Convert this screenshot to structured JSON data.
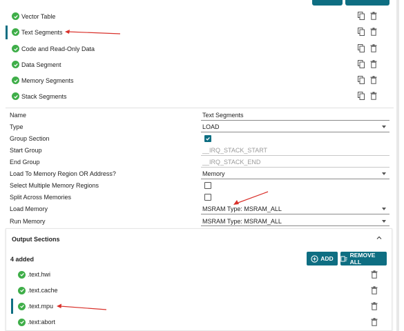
{
  "segments": [
    {
      "label": "Vector Table"
    },
    {
      "label": "Text Segments"
    },
    {
      "label": "Code and Read-Only Data"
    },
    {
      "label": "Data Segment"
    },
    {
      "label": "Memory Segments"
    },
    {
      "label": "Stack Segments"
    }
  ],
  "form": {
    "name_label": "Name",
    "name_value": "Text Segments",
    "type_label": "Type",
    "type_value": "LOAD",
    "group_section_label": "Group Section",
    "start_group_label": "Start Group",
    "start_group_placeholder": "__IRQ_STACK_START",
    "end_group_label": "End Group",
    "end_group_placeholder": "__IRQ_STACK_END",
    "load_to_label": "Load To Memory Region OR Address?",
    "load_to_value": "Memory",
    "select_multiple_label": "Select Multiple Memory Regions",
    "split_across_label": "Split Across Memories",
    "load_memory_label": "Load Memory",
    "load_memory_value": "MSRAM Type: MSRAM_ALL",
    "run_memory_label": "Run Memory",
    "run_memory_value": "MSRAM Type: MSRAM_ALL",
    "group_section_checked": true,
    "select_multiple_checked": false,
    "split_across_checked": false
  },
  "output_sections": {
    "title": "Output Sections",
    "count_label": "4 added",
    "add_label": "ADD",
    "remove_all_label": "REMOVE ALL",
    "items": [
      {
        "label": ".text.hwi"
      },
      {
        "label": ".text.cache"
      },
      {
        "label": ".text.mpu"
      },
      {
        "label": ".text:abort"
      }
    ]
  },
  "colors": {
    "accent": "#0e6e82",
    "check_green": "#3fae49",
    "arrow_red": "#d9302a"
  },
  "icons": [
    "check-circle-icon",
    "copy-icon",
    "delete-icon",
    "chevron-up-icon",
    "add-circle-icon",
    "remove-all-icon",
    "dropdown-caret-icon"
  ]
}
